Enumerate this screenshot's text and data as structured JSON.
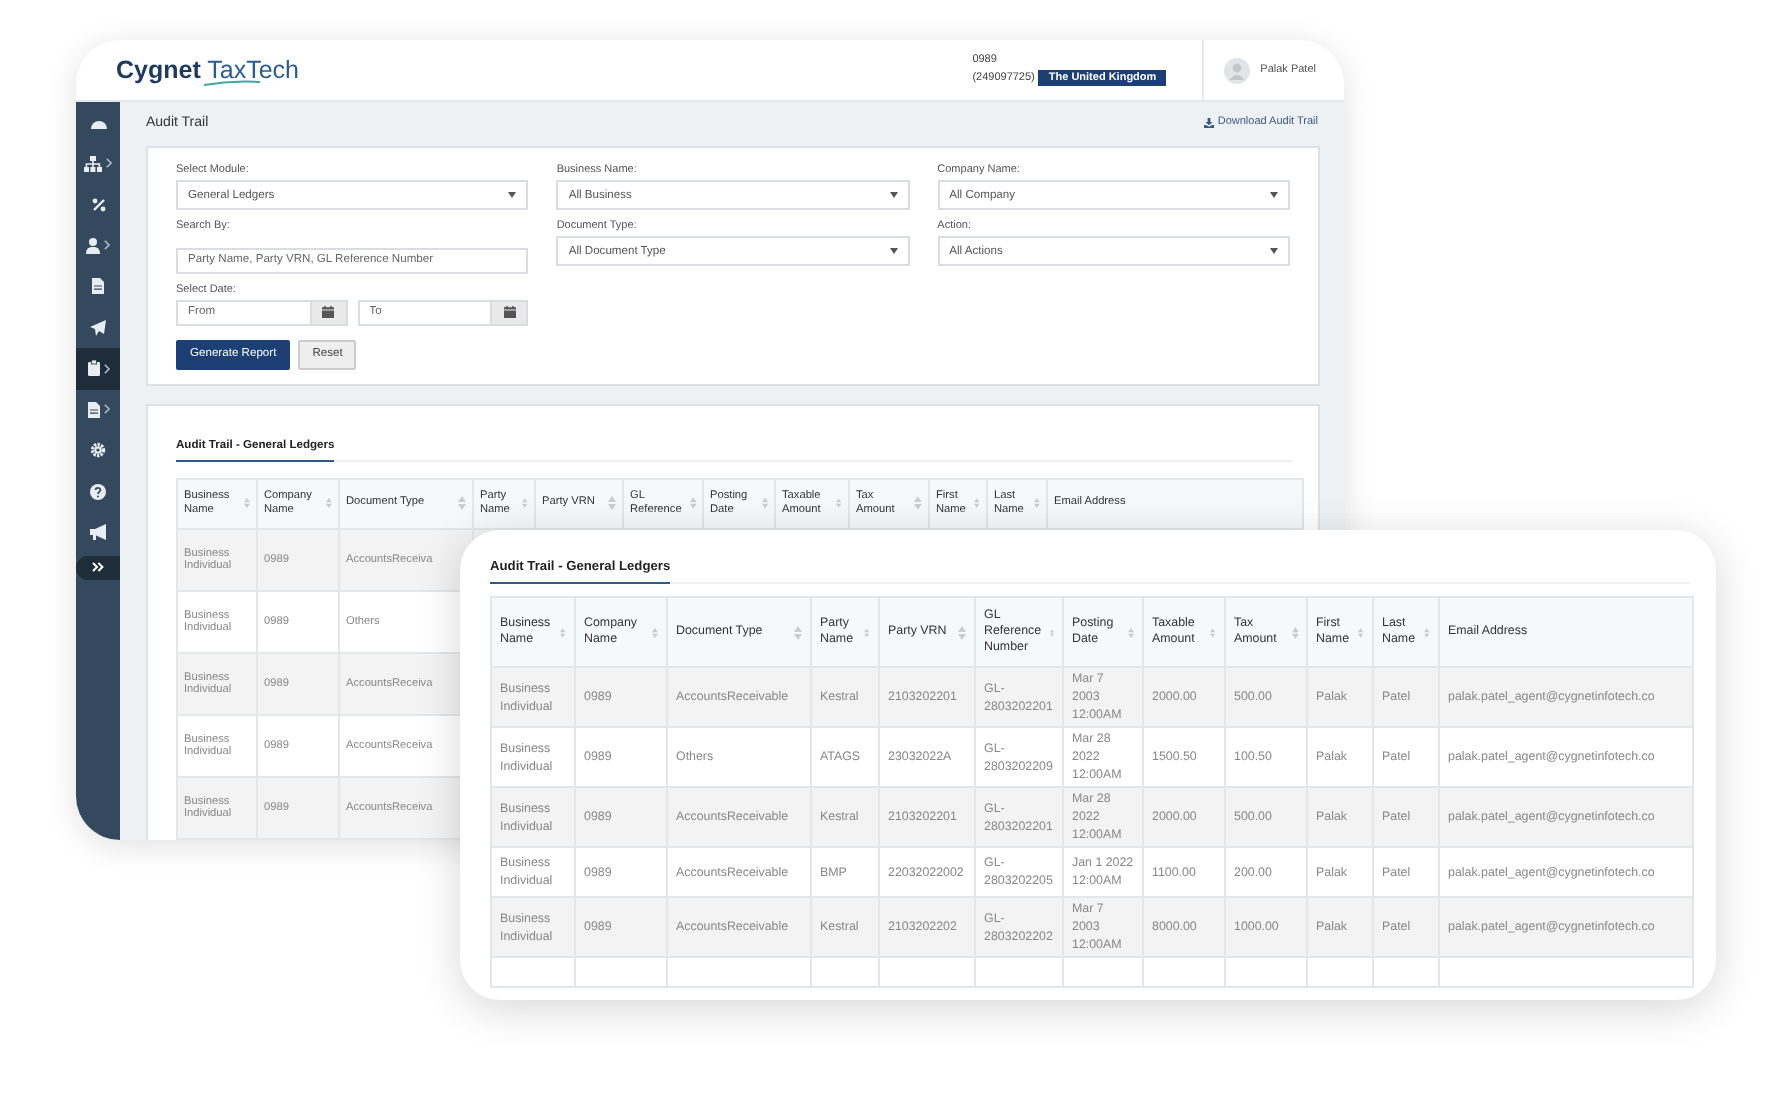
{
  "header": {
    "logo": {
      "brand": "Cygnet",
      "product": "TaxTech"
    },
    "account": {
      "code": "0989",
      "id": "(249097725)",
      "country": "The United Kingdom"
    },
    "user": {
      "name": "Palak Patel"
    }
  },
  "sidebar": {
    "items": [
      {
        "selected": false,
        "submenu": false
      },
      {
        "selected": false,
        "submenu": true
      },
      {
        "selected": false,
        "submenu": false
      },
      {
        "selected": false,
        "submenu": true
      },
      {
        "selected": false,
        "submenu": false
      },
      {
        "selected": false,
        "submenu": false
      },
      {
        "selected": true,
        "submenu": true
      },
      {
        "selected": false,
        "submenu": true
      },
      {
        "selected": false,
        "submenu": false
      },
      {
        "selected": false,
        "submenu": false
      },
      {
        "selected": false,
        "submenu": false
      }
    ]
  },
  "page": {
    "title": "Audit Trail",
    "download_link": "Download Audit Trail"
  },
  "filters": {
    "fields": [
      {
        "label": "Select Module:",
        "kind": "select",
        "value": "General Ledgers"
      },
      {
        "label": "Business Name:",
        "kind": "select",
        "value": "All Business"
      },
      {
        "label": "Company Name:",
        "kind": "select",
        "value": "All Company"
      },
      {
        "label": "Search By:",
        "kind": "text",
        "placeholder": "Party Name, Party VRN, GL Reference Number"
      },
      {
        "label": "Document Type:",
        "kind": "select",
        "value": "All Document Type"
      },
      {
        "label": "Action:",
        "kind": "select",
        "value": "All Actions"
      }
    ],
    "date": {
      "label": "Select Date:",
      "from_placeholder": "From",
      "to_placeholder": "To"
    },
    "buttons": [
      {
        "label": "Generate Report",
        "kind": "primary"
      },
      {
        "label": "Reset",
        "kind": "secondary"
      }
    ]
  },
  "back_table": {
    "title": "Audit Trail - General Ledgers",
    "columns": [
      "Business Name",
      "Company Name",
      "Document Type",
      "Party Name",
      "Party VRN",
      "GL Reference",
      "Posting Date",
      "Taxable Amount",
      "Tax Amount",
      "First Name",
      "Last Name",
      "Email Address"
    ],
    "rows": [
      [
        "Business Individual",
        "0989",
        "AccountsReceiva"
      ],
      [
        "Business Individual",
        "0989",
        "Others"
      ],
      [
        "Business Individual",
        "0989",
        "AccountsReceiva"
      ],
      [
        "Business Individual",
        "0989",
        "AccountsReceiva"
      ],
      [
        "Business Individual",
        "0989",
        "AccountsReceiva"
      ]
    ]
  },
  "front_table": {
    "title": "Audit Trail - General Ledgers",
    "columns": [
      "Business Name",
      "Company Name",
      "Document Type",
      "Party Name",
      "Party VRN",
      "GL Reference Number",
      "Posting Date",
      "Taxable Amount",
      "Tax Amount",
      "First Name",
      "Last Name",
      "Email Address"
    ],
    "rows": [
      [
        "Business Individual",
        "0989",
        "AccountsReceivable",
        "Kestral",
        "2103202201",
        "GL-2803202201",
        "Mar 7 2003 12:00AM",
        "2000.00",
        "500.00",
        "Palak",
        "Patel",
        "palak.patel_agent@cygnetinfotech.co"
      ],
      [
        "Business Individual",
        "0989",
        "Others",
        "ATAGS",
        "23032022A",
        "GL-2803202209",
        "Mar 28 2022 12:00AM",
        "1500.50",
        "100.50",
        "Palak",
        "Patel",
        "palak.patel_agent@cygnetinfotech.co"
      ],
      [
        "Business Individual",
        "0989",
        "AccountsReceivable",
        "Kestral",
        "2103202201",
        "GL-2803202201",
        "Mar 28 2022 12:00AM",
        "2000.00",
        "500.00",
        "Palak",
        "Patel",
        "palak.patel_agent@cygnetinfotech.co"
      ],
      [
        "Business Individual",
        "0989",
        "AccountsReceivable",
        "BMP",
        "22032022002",
        "GL-2803202205",
        "Jan 1 2022 12:00AM",
        "1100.00",
        "200.00",
        "Palak",
        "Patel",
        "palak.patel_agent@cygnetinfotech.co"
      ],
      [
        "Business Individual",
        "0989",
        "AccountsReceivable",
        "Kestral",
        "2103202202",
        "GL-2803202202",
        "Mar 7 2003 12:00AM",
        "8000.00",
        "1000.00",
        "Palak",
        "Patel",
        "palak.patel_agent@cygnetinfotech.co"
      ]
    ]
  }
}
